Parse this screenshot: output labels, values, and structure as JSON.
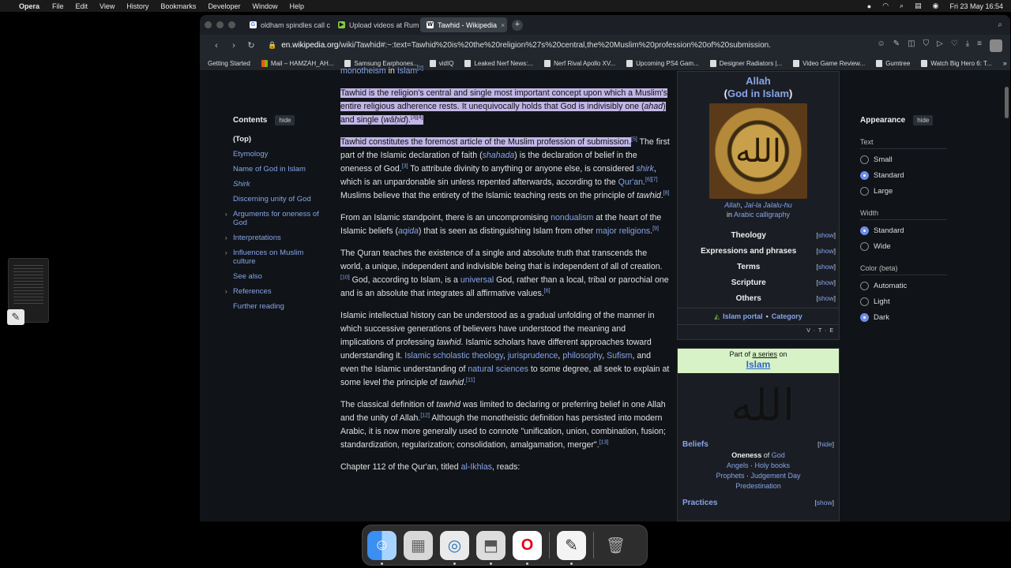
{
  "menubar": {
    "app": "Opera",
    "items": [
      "File",
      "Edit",
      "View",
      "History",
      "Bookmarks",
      "Developer",
      "Window",
      "Help"
    ],
    "datetime": "Fri 23 May  16:54"
  },
  "tabs": [
    {
      "label": "oldham spindles call cen",
      "icon_color": "#4285f4"
    },
    {
      "label": "Upload videos at Rumble",
      "icon_color": "#85c742"
    },
    {
      "label": "Tawhid - Wikipedia",
      "icon_color": "#ffffff"
    }
  ],
  "address": {
    "domain": "en.wikipedia.org",
    "path": "/wiki/Tawhid#:~:text=Tawhid%20is%20the%20religion%27s%20central,the%20Muslim%20profession%20of%20submission."
  },
  "bookmarks": [
    "Getting Started",
    "Mail – HAMZAH_AH...",
    "Samsung Earphones...",
    "vidIQ",
    "Leaked Nerf News:...",
    "Nerf Rival Apollo XV...",
    "Upcoming PS4 Gam...",
    "Designer Radiators |...",
    "Video Game Review...",
    "Gumtree",
    "Watch Big Hero 6: T..."
  ],
  "toc": {
    "title": "Contents",
    "hide": "hide",
    "items": [
      {
        "label": "(Top)",
        "top": true
      },
      {
        "label": "Etymology"
      },
      {
        "label": "Name of God in Islam"
      },
      {
        "label": "Shirk",
        "italic": true
      },
      {
        "label": "Discerning unity of God"
      },
      {
        "label": "Arguments for oneness of God",
        "chevron": true
      },
      {
        "label": "Interpretations",
        "chevron": true
      },
      {
        "label": "Influences on Muslim culture",
        "chevron": true
      },
      {
        "label": "See also"
      },
      {
        "label": "References",
        "chevron": true
      },
      {
        "label": "Further reading"
      }
    ]
  },
  "article": {
    "p0": {
      "link1": "monotheism",
      "t1": " in ",
      "link2": "Islam",
      "ref": "[2]"
    },
    "p1": {
      "hl": "Tawhid is the religion's central and single most important concept upon which a Muslim's entire religious adherence rests. It unequivocally holds that God is indivisibly one (",
      "i1": "ahad",
      "t2": ") and single (",
      "i2": "wāḥid",
      "t3": ").",
      "ref": "[3][4]"
    },
    "p2": {
      "hl": "Tawhid constitutes the foremost article of the Muslim profession of submission.",
      "ref1": "[5]",
      "t1": " The first part of the Islamic declaration of faith (",
      "link1": "shahada",
      "t2": ") is the declaration of belief in the oneness of God.",
      "ref2": "[3]",
      "t3": " To attribute divinity to anything or anyone else, is considered ",
      "link2": "shirk",
      "t4": ", which is an unpardonable sin unless repented afterwards, according to the ",
      "link3": "Qur'an",
      "ref3": "[6][7]",
      "t5": " Muslims believe that the entirety of the Islamic teaching rests on the principle of ",
      "i1": "tawhid",
      "ref4": "[8]"
    },
    "p3": {
      "t1": "From an Islamic standpoint, there is an uncompromising ",
      "link1": "nondualism",
      "t2": " at the heart of the Islamic beliefs (",
      "link2": "aqida",
      "t3": ") that is seen as distinguishing Islam from other ",
      "link3": "major religions",
      "ref": "[9]"
    },
    "p4": {
      "t1": "The Quran teaches the existence of a single and absolute truth that transcends the world, a unique, independent and indivisible being that is independent of all of creation.",
      "ref1": "[10]",
      "t2": " God, according to Islam, is a ",
      "link1": "universal",
      "t3": " God, rather than a local, tribal or parochial one and is an absolute that integrates all affirmative values.",
      "ref2": "[6]"
    },
    "p5": {
      "t1": "Islamic intellectual history can be understood as a gradual unfolding of the manner in which successive generations of believers have understood the meaning and implications of professing ",
      "i1": "tawhid",
      "t2": ". Islamic scholars have different approaches toward understanding it. ",
      "link1": "Islamic scholastic theology",
      "link2": "jurisprudence",
      "link3": "philosophy",
      "link4": "Sufism",
      "t3": ", and even the Islamic understanding of ",
      "link5": "natural sciences",
      "t4": " to some degree, all seek to explain at some level the principle of ",
      "i2": "tawhid",
      "ref": "[11]"
    },
    "p6": {
      "t1": "The classical definition of ",
      "i1": "tawhid",
      "t2": " was limited to declaring or preferring belief in one Allah and the unity of Allah.",
      "ref1": "[12]",
      "t3": " Although the monotheistic definition has persisted into modern Arabic, it is now more generally used to connote \"unification, union, combination, fusion; standardization, regularization; consolidation, amalgamation, merger\".",
      "ref2": "[13]"
    },
    "p7": {
      "t1": "Chapter 112 of the Qur'an, titled ",
      "link1": "al-Ikhlas",
      "t2": ", reads:"
    }
  },
  "infobox": {
    "title": "Allah",
    "subtitle_open": "(",
    "subtitle_link": "God in Islam",
    "subtitle_close": ")",
    "image_glyph": "الله",
    "caption_link1": "Allah",
    "caption_link2": "Jal-la Jalalu-hu",
    "caption_t": "in ",
    "caption_link3": "Arabic calligraphy",
    "rows": [
      {
        "label": "Theology",
        "show": "show"
      },
      {
        "label": "Expressions and phrases",
        "show": "show"
      },
      {
        "label": "Terms",
        "show": "show"
      },
      {
        "label": "Scripture",
        "show": "show"
      },
      {
        "label": "Others",
        "show": "show"
      }
    ],
    "portal": "Islam portal",
    "category": "Category",
    "vte": "V · T · E"
  },
  "series": {
    "part_of": "Part of ",
    "a_series": "a series",
    "on": " on",
    "name": "Islam",
    "glyph": "الله",
    "beliefs": "Beliefs",
    "hide": "hide",
    "oneness": "Oneness",
    "of": " of ",
    "god": "God",
    "angels": "Angels",
    "holy_books": "Holy books",
    "prophets": "Prophets",
    "judgement_day": "Judgement Day",
    "predestination": "Predestination",
    "practices": "Practices",
    "show": "show"
  },
  "appearance": {
    "title": "Appearance",
    "hide": "hide",
    "text_label": "Text",
    "text_options": [
      {
        "label": "Small",
        "on": false
      },
      {
        "label": "Standard",
        "on": true
      },
      {
        "label": "Large",
        "on": false
      }
    ],
    "width_label": "Width",
    "width_options": [
      {
        "label": "Standard",
        "on": true
      },
      {
        "label": "Wide",
        "on": false
      }
    ],
    "color_label": "Color (beta)",
    "color_options": [
      {
        "label": "Automatic",
        "on": false
      },
      {
        "label": "Light",
        "on": false
      },
      {
        "label": "Dark",
        "on": true
      }
    ]
  }
}
